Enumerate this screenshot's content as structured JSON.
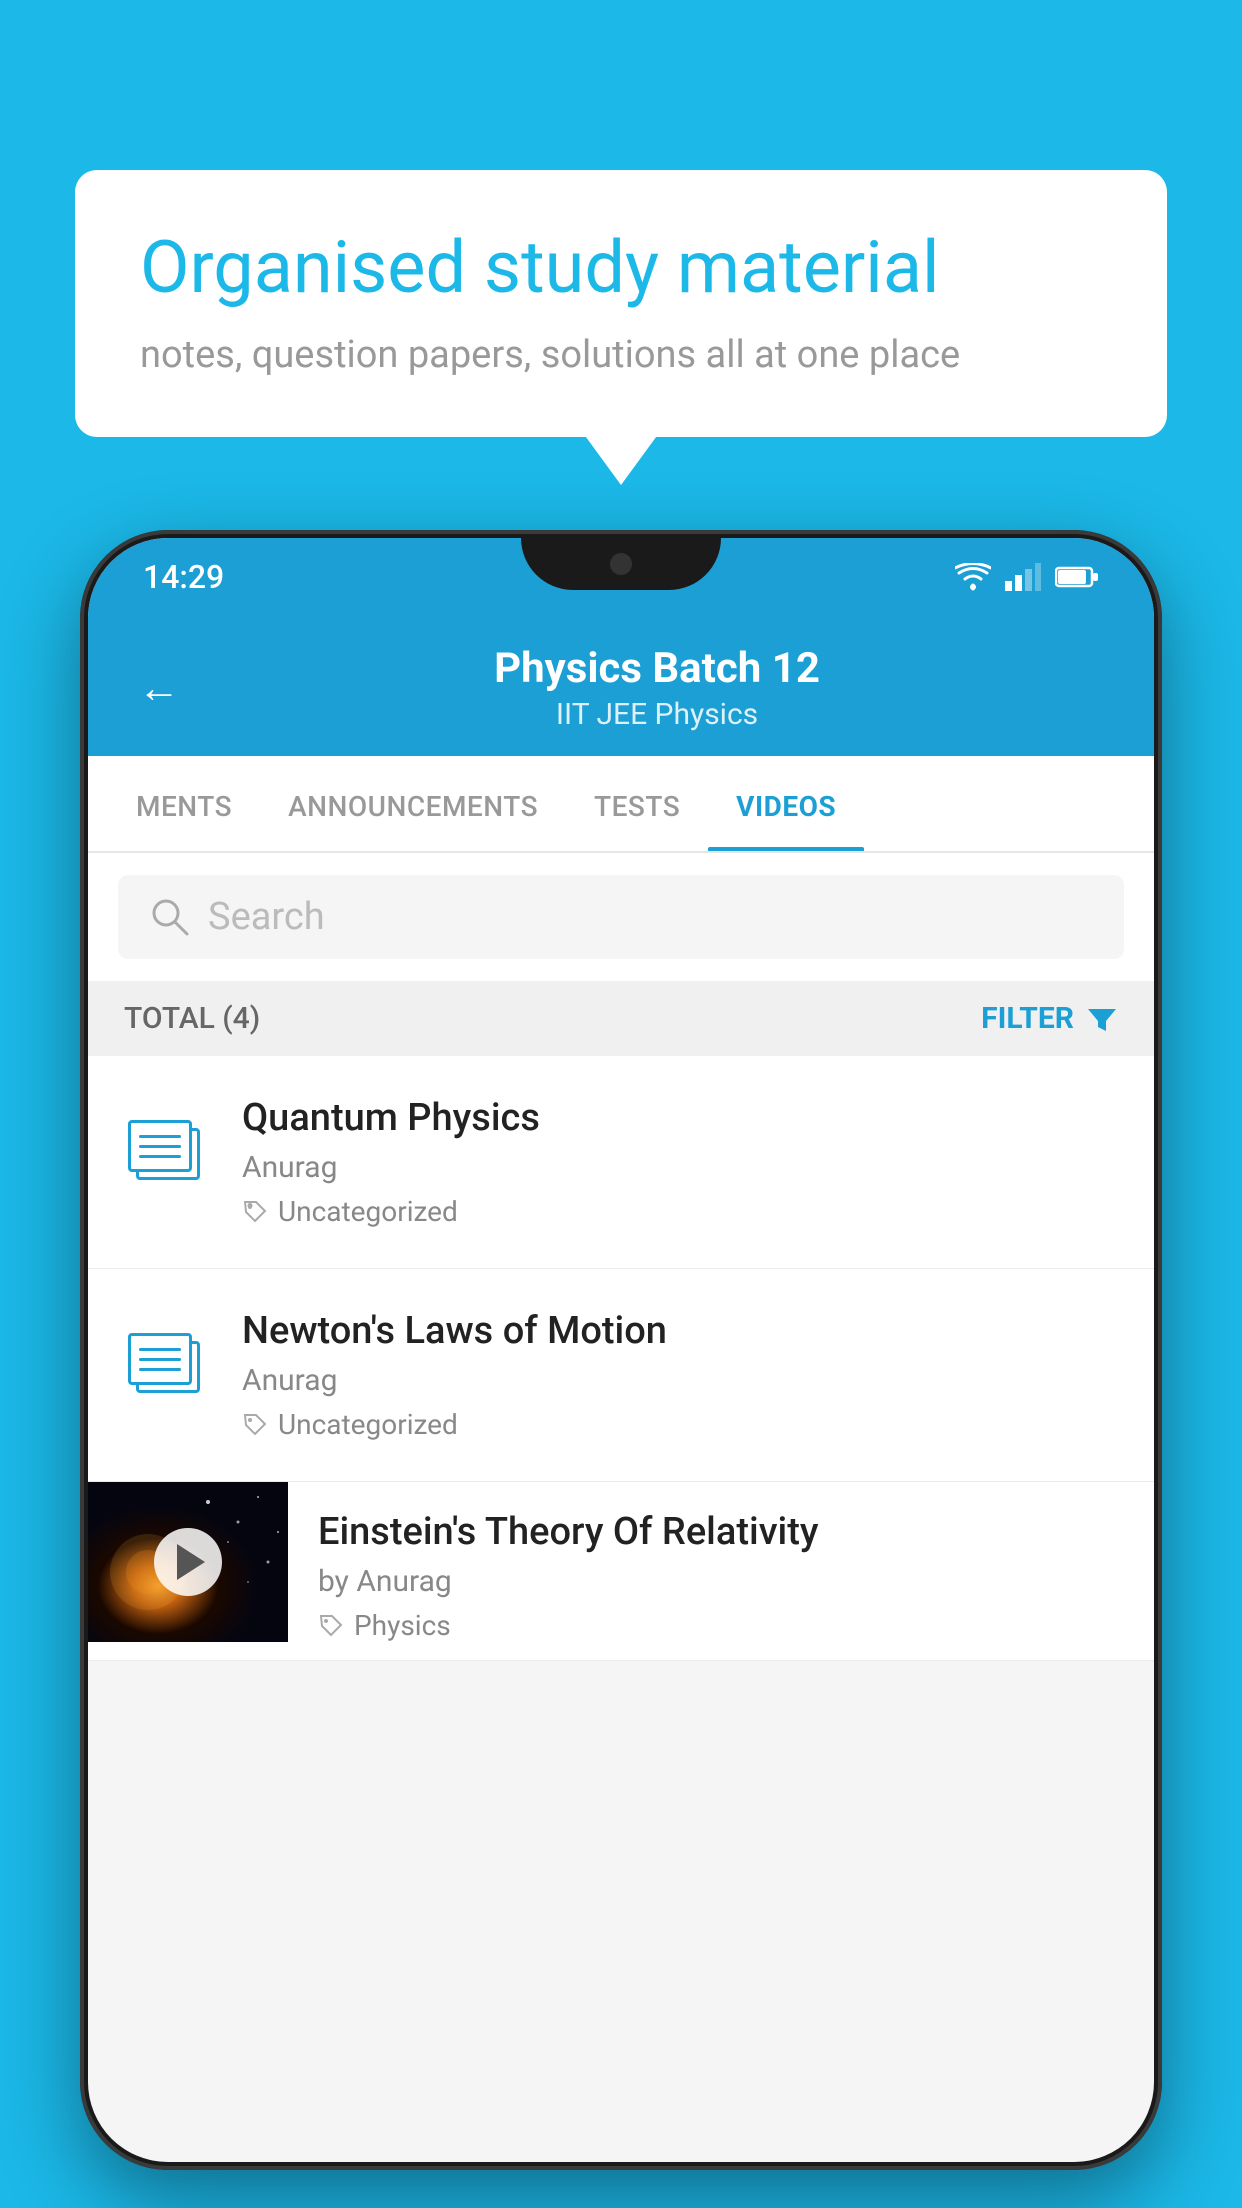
{
  "background": {
    "color": "#1bb8e8"
  },
  "bubble": {
    "title": "Organised study material",
    "subtitle": "notes, question papers, solutions all at one place"
  },
  "phone": {
    "status_bar": {
      "time": "14:29"
    },
    "header": {
      "title": "Physics Batch 12",
      "subtitle": "IIT JEE   Physics",
      "back_label": "←"
    },
    "tabs": [
      {
        "label": "MENTS",
        "active": false
      },
      {
        "label": "ANNOUNCEMENTS",
        "active": false
      },
      {
        "label": "TESTS",
        "active": false
      },
      {
        "label": "VIDEOS",
        "active": true
      }
    ],
    "search": {
      "placeholder": "Search"
    },
    "filter": {
      "total_label": "TOTAL (4)",
      "filter_label": "FILTER"
    },
    "videos": [
      {
        "id": "quantum",
        "title": "Quantum Physics",
        "author": "Anurag",
        "tag": "Uncategorized",
        "has_thumbnail": false
      },
      {
        "id": "newton",
        "title": "Newton's Laws of Motion",
        "author": "Anurag",
        "tag": "Uncategorized",
        "has_thumbnail": false
      },
      {
        "id": "einstein",
        "title": "Einstein's Theory Of Relativity",
        "author": "by Anurag",
        "tag": "Physics",
        "has_thumbnail": true
      }
    ]
  }
}
